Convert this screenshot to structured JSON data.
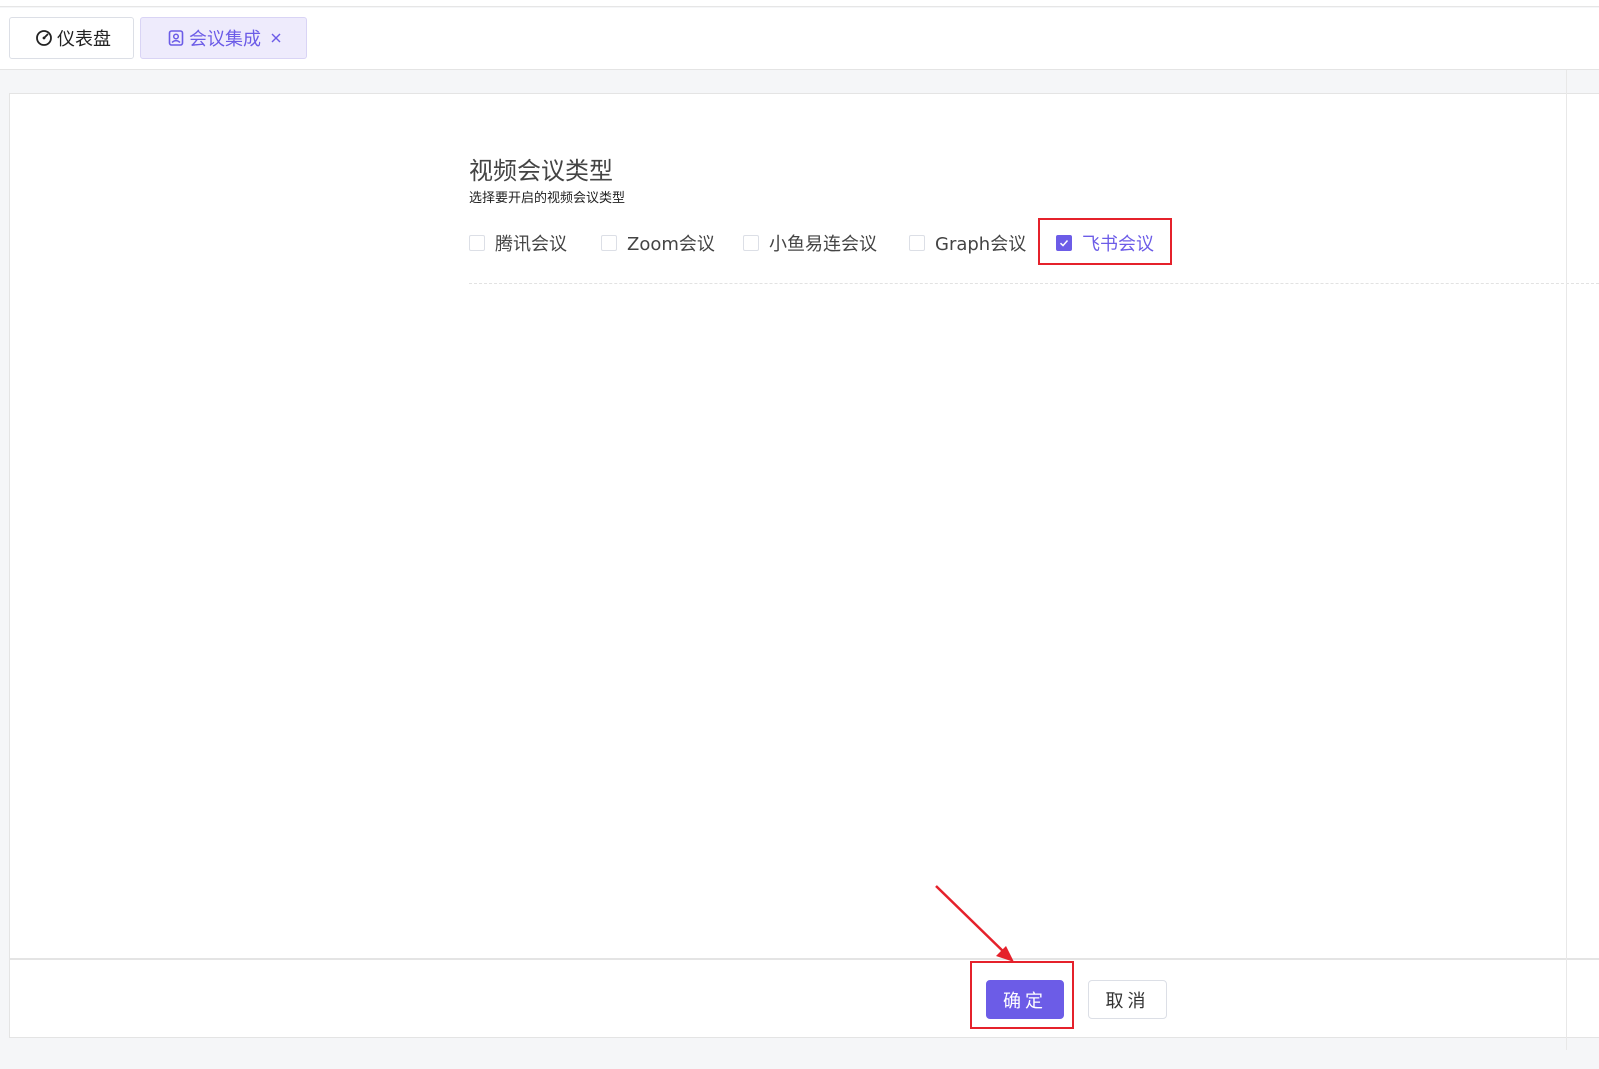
{
  "tabs": [
    {
      "label": "仪表盘",
      "icon": "dashboard-gauge-icon",
      "active": false
    },
    {
      "label": "会议集成",
      "icon": "meeting-integration-icon",
      "active": true,
      "closable": true
    }
  ],
  "section": {
    "title": "视频会议类型",
    "subtitle": "选择要开启的视频会议类型"
  },
  "meeting_types": [
    {
      "label": "腾讯会议",
      "checked": false
    },
    {
      "label": "Zoom会议",
      "checked": false
    },
    {
      "label": "小鱼易连会议",
      "checked": false
    },
    {
      "label": "Graph会议",
      "checked": false
    },
    {
      "label": "飞书会议",
      "checked": true
    }
  ],
  "footer": {
    "confirm_label": "确定",
    "cancel_label": "取消"
  },
  "colors": {
    "accent": "#6c5ce7",
    "accent_light": "#eeebfc",
    "annotation_red": "#e5212b",
    "border": "#dcdfe6"
  }
}
